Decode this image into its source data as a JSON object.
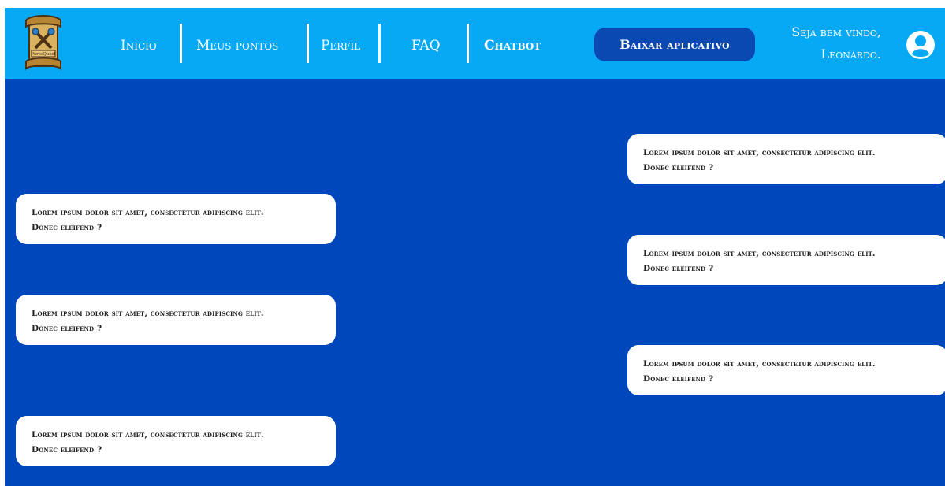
{
  "header": {
    "logo_text": "PortoQuest",
    "nav": [
      {
        "label": "Inicio"
      },
      {
        "label": "Meus pontos"
      },
      {
        "label": "Perfil"
      },
      {
        "label": "FAQ"
      },
      {
        "label": "Chatbot"
      }
    ],
    "download_label": "Baixar aplicativo",
    "welcome_line1": "Seja bem vindo,",
    "welcome_line2": "Leonardo."
  },
  "icons": {
    "logo": "scroll-logo-icon",
    "avatar": "user-avatar-icon"
  },
  "colors": {
    "background": "#0047bb",
    "navbar": "#07a9f4",
    "button": "#0a49b2",
    "bubble": "#ffffff"
  },
  "chat": {
    "messages": [
      {
        "side": "right",
        "line1": "Lorem ipsum dolor sit amet, consectetur adipiscing elit.",
        "line2": "Donec eleifend ?"
      },
      {
        "side": "left",
        "line1": "Lorem ipsum dolor sit amet, consectetur adipiscing elit.",
        "line2": "Donec eleifend ?"
      },
      {
        "side": "right",
        "line1": "Lorem ipsum dolor sit amet, consectetur adipiscing elit.",
        "line2": "Donec eleifend ?"
      },
      {
        "side": "left",
        "line1": "Lorem ipsum dolor sit amet, consectetur adipiscing elit.",
        "line2": "Donec eleifend ?"
      },
      {
        "side": "right",
        "line1": "Lorem ipsum dolor sit amet, consectetur adipiscing elit.",
        "line2": "Donec eleifend ?"
      },
      {
        "side": "left",
        "line1": "Lorem ipsum dolor sit amet, consectetur adipiscing elit.",
        "line2": "Donec eleifend ?"
      }
    ]
  }
}
